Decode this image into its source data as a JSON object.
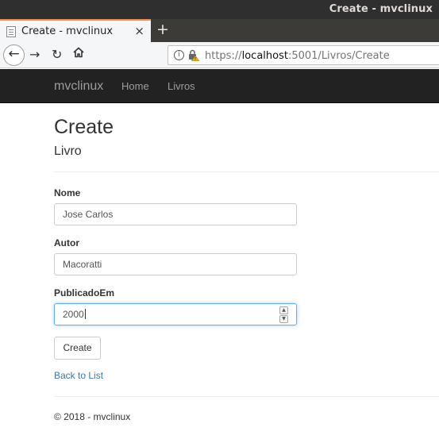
{
  "os": {
    "window_title": "Create - mvclinux"
  },
  "browser": {
    "tab_title": "Create - mvclinux",
    "tab_close": "×",
    "new_tab": "+",
    "back": "←",
    "forward": "→",
    "reload": "↻",
    "url_scheme": "https://",
    "url_host": "localhost",
    "url_rest": ":5001/Livros/Create",
    "info": "i"
  },
  "site_nav": {
    "brand": "mvclinux",
    "links": [
      "Home",
      "Livros"
    ]
  },
  "page": {
    "title": "Create",
    "subtitle": "Livro"
  },
  "form": {
    "fields": [
      {
        "label": "Nome",
        "value": "Jose Carlos"
      },
      {
        "label": "Autor",
        "value": "Macoratti"
      },
      {
        "label": "PublicadoEm",
        "value": "2000"
      }
    ],
    "submit_label": "Create",
    "spin_up": "▲",
    "spin_down": "▼"
  },
  "links": {
    "back": "Back to List"
  },
  "footer": {
    "text": "© 2018 - mvclinux"
  },
  "colors": {
    "navbar_bg": "#222222",
    "link": "#337ab7",
    "focus": "#66afe9",
    "tab_accent": "#ff8a3d"
  }
}
